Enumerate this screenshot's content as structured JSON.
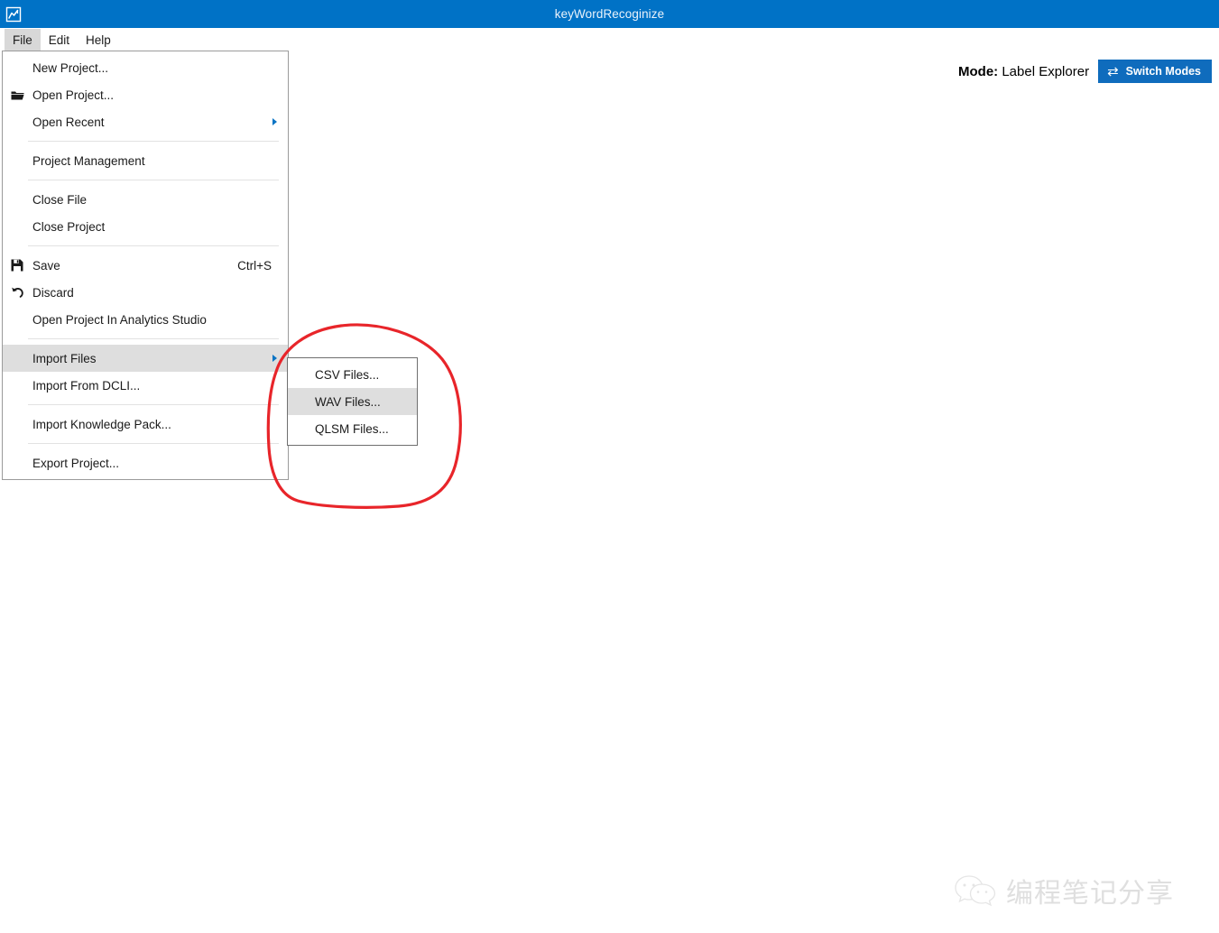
{
  "window": {
    "title": "keyWordRecoginize",
    "icon": "chart-line-icon",
    "titlebar_color": "#0072c6"
  },
  "menubar": {
    "items": [
      {
        "label": "File",
        "active": true
      },
      {
        "label": "Edit",
        "active": false
      },
      {
        "label": "Help",
        "active": false
      }
    ]
  },
  "file_menu": {
    "items": [
      {
        "label": "New Project...",
        "icon": null,
        "shortcut": null,
        "submenu": false,
        "highlight": false
      },
      {
        "label": "Open Project...",
        "icon": "folder-open-icon",
        "shortcut": null,
        "submenu": false,
        "highlight": false
      },
      {
        "label": "Open Recent",
        "icon": null,
        "shortcut": null,
        "submenu": true,
        "highlight": false
      },
      {
        "label": "Project Management",
        "icon": null,
        "shortcut": null,
        "submenu": false,
        "highlight": false
      },
      {
        "label": "Close File",
        "icon": null,
        "shortcut": null,
        "submenu": false,
        "highlight": false
      },
      {
        "label": "Close Project",
        "icon": null,
        "shortcut": null,
        "submenu": false,
        "highlight": false
      },
      {
        "label": "Save",
        "icon": "floppy-disk-icon",
        "shortcut": "Ctrl+S",
        "submenu": false,
        "highlight": false
      },
      {
        "label": "Discard",
        "icon": "undo-arrow-icon",
        "shortcut": null,
        "submenu": false,
        "highlight": false
      },
      {
        "label": "Open Project In Analytics Studio",
        "icon": null,
        "shortcut": null,
        "submenu": false,
        "highlight": false
      },
      {
        "label": "Import Files",
        "icon": null,
        "shortcut": null,
        "submenu": true,
        "highlight": true
      },
      {
        "label": "Import From DCLI...",
        "icon": null,
        "shortcut": null,
        "submenu": false,
        "highlight": false
      },
      {
        "label": "Import Knowledge Pack...",
        "icon": null,
        "shortcut": null,
        "submenu": false,
        "highlight": false
      },
      {
        "label": "Export Project...",
        "icon": null,
        "shortcut": null,
        "submenu": false,
        "highlight": false
      }
    ]
  },
  "import_submenu": {
    "items": [
      {
        "label": "CSV Files...",
        "highlight": false
      },
      {
        "label": "WAV Files...",
        "highlight": true
      },
      {
        "label": "QLSM Files...",
        "highlight": false
      }
    ]
  },
  "header": {
    "mode_prefix": "Mode:",
    "mode_value": "Label Explorer",
    "switch_button_label": "Switch Modes",
    "switch_button_icon": "swap-arrows-icon",
    "accent_color": "#0f6cbd"
  },
  "annotation": {
    "shape": "hand-drawn-circle",
    "color": "#e8252a"
  },
  "watermark": {
    "text": "编程笔记分享",
    "icon": "wechat-logo-icon"
  }
}
